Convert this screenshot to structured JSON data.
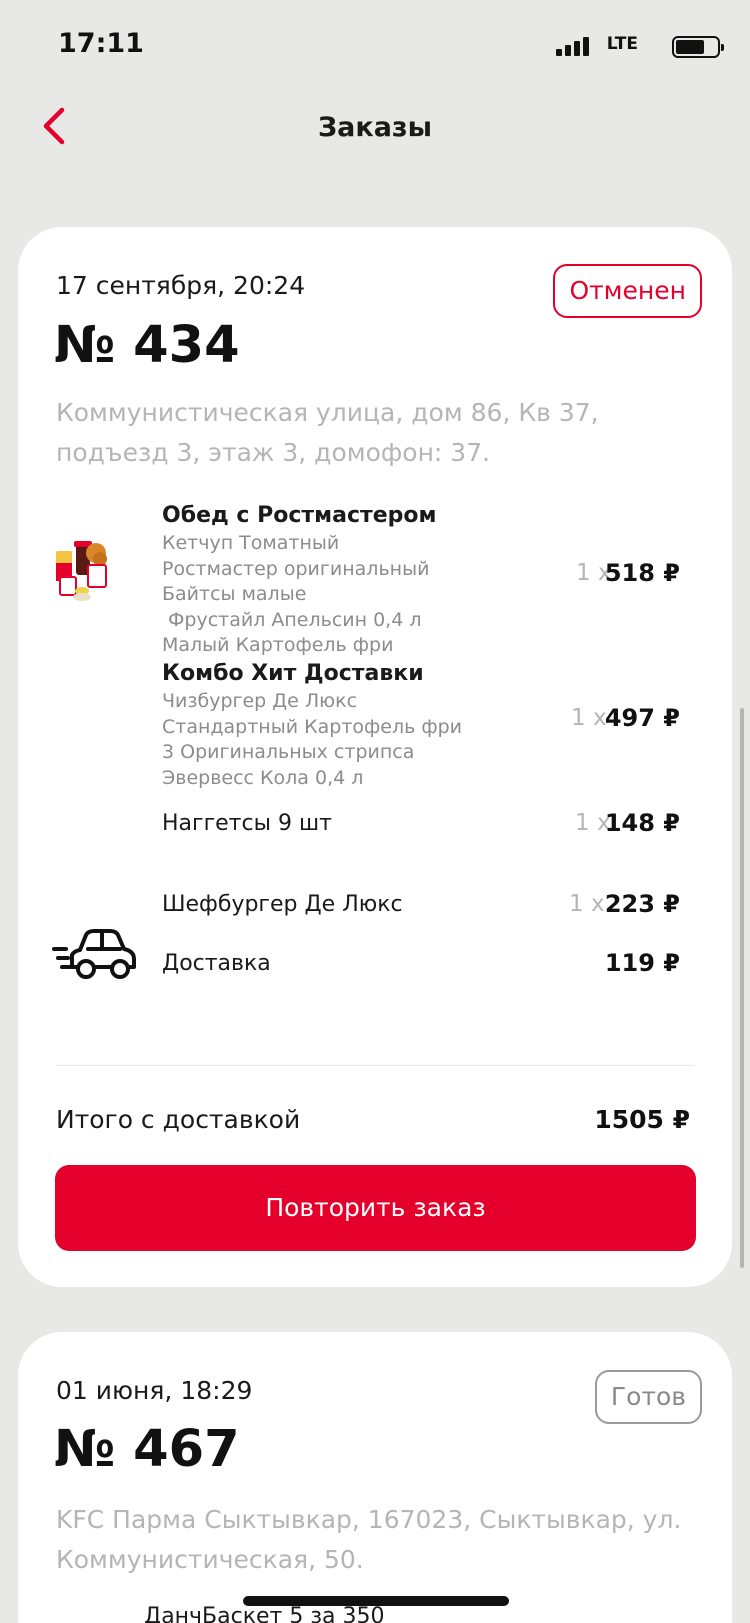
{
  "status_bar": {
    "time": "17:11",
    "network": "LTE"
  },
  "nav": {
    "title": "Заказы"
  },
  "orders": [
    {
      "date": "17 сентября, 20:24",
      "status": "Отменен",
      "number": "№ 434",
      "address": "Коммунистическая улица, дом 86, Кв 37, подъезд 3, этаж 3, домофон: 37.",
      "items": [
        {
          "title": "Обед с Ростмастером",
          "components": "Кетчуп Томатный\nРостмастер оригинальный\nБайтсы малые\n Фрустайл Апельсин 0,4 л\nМалый Картофель фри",
          "qty": "1 x",
          "price": "518 ₽"
        },
        {
          "title": "Комбо Хит Доставки",
          "components": "Чизбургер Де Люкс\nСтандартный Картофель фри\n3 Оригинальных стрипса\nЭвервесс Кола 0,4 л",
          "qty": "1 x",
          "price": "497 ₽"
        },
        {
          "title": "Наггетсы 9 шт",
          "qty": "1 x",
          "price": "148 ₽"
        },
        {
          "title": "Шефбургер Де Люкс",
          "qty": "1 x",
          "price": "223 ₽"
        }
      ],
      "delivery": {
        "label": "Доставка",
        "price": "119 ₽"
      },
      "total": {
        "label": "Итого с доставкой",
        "value": "1505 ₽"
      },
      "repeat_label": "Повторить заказ"
    },
    {
      "date": "01 июня, 18:29",
      "status": "Готов",
      "number": "№ 467",
      "address": "KFC Парма Сыктывкар, 167023, Сыктывкар, ул. Коммунистическая, 50.",
      "items": [
        {
          "title": "ДанчБаскет 5 за 350"
        }
      ]
    }
  ],
  "colors": {
    "accent": "#e4002b",
    "background": "#e8e8e6",
    "muted": "#b5b5b5"
  },
  "icons": {
    "back": "chevron-left-icon",
    "delivery": "car-icon",
    "signal": "signal-icon",
    "battery": "battery-icon"
  }
}
